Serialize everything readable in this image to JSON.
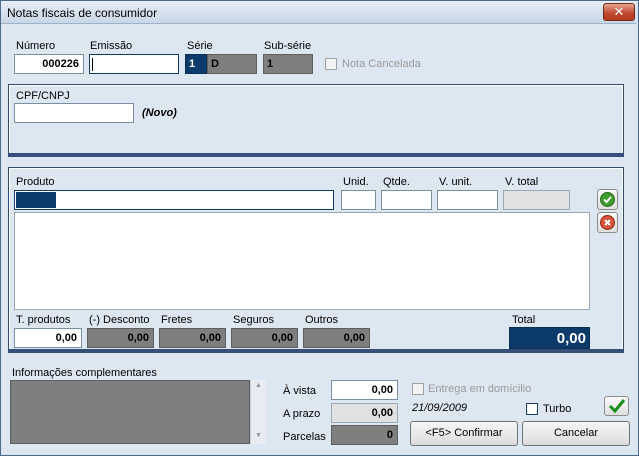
{
  "window": {
    "title": "Notas fiscais de consumidor",
    "close_glyph": "✕"
  },
  "header": {
    "numero_label": "Número",
    "numero_value": "000226",
    "emissao_label": "Emissão",
    "emissao_value": "",
    "serie_label": "Série",
    "serie_value_a": "1",
    "serie_value_b": "D",
    "subserie_label": "Sub-série",
    "subserie_value": "1",
    "cancelada_label": "Nota Cancelada"
  },
  "customer": {
    "cpf_label": "CPF/CNPJ",
    "cpf_value": "",
    "status": "(Novo)"
  },
  "items": {
    "produto_label": "Produto",
    "unid_label": "Unid.",
    "qtde_label": "Qtde.",
    "vunit_label": "V. unit.",
    "vtotal_label": "V. total"
  },
  "totals": {
    "tprodutos_label": "T. produtos",
    "tprodutos_value": "0,00",
    "desconto_label": "(-) Desconto",
    "desconto_value": "0,00",
    "fretes_label": "Fretes",
    "fretes_value": "0,00",
    "seguros_label": "Seguros",
    "seguros_value": "0,00",
    "outros_label": "Outros",
    "outros_value": "0,00",
    "total_label": "Total",
    "total_value": "0,00"
  },
  "footer": {
    "info_label": "Informações complementares",
    "avista_label": "À vista",
    "avista_value": "0,00",
    "aprazo_label": "A prazo",
    "aprazo_value": "0,00",
    "parcelas_label": "Parcelas",
    "parcelas_value": "0",
    "entrega_label": "Entrega em domícilio",
    "date": "21/09/2009",
    "turbo_label": "Turbo",
    "confirm_label": "<F5> Confirmar",
    "cancel_label": "Cancelar"
  },
  "colors": {
    "accent": "#0c3b6b",
    "panel_border": "#2f4a6c",
    "disabled_field": "#7f7f7f"
  }
}
